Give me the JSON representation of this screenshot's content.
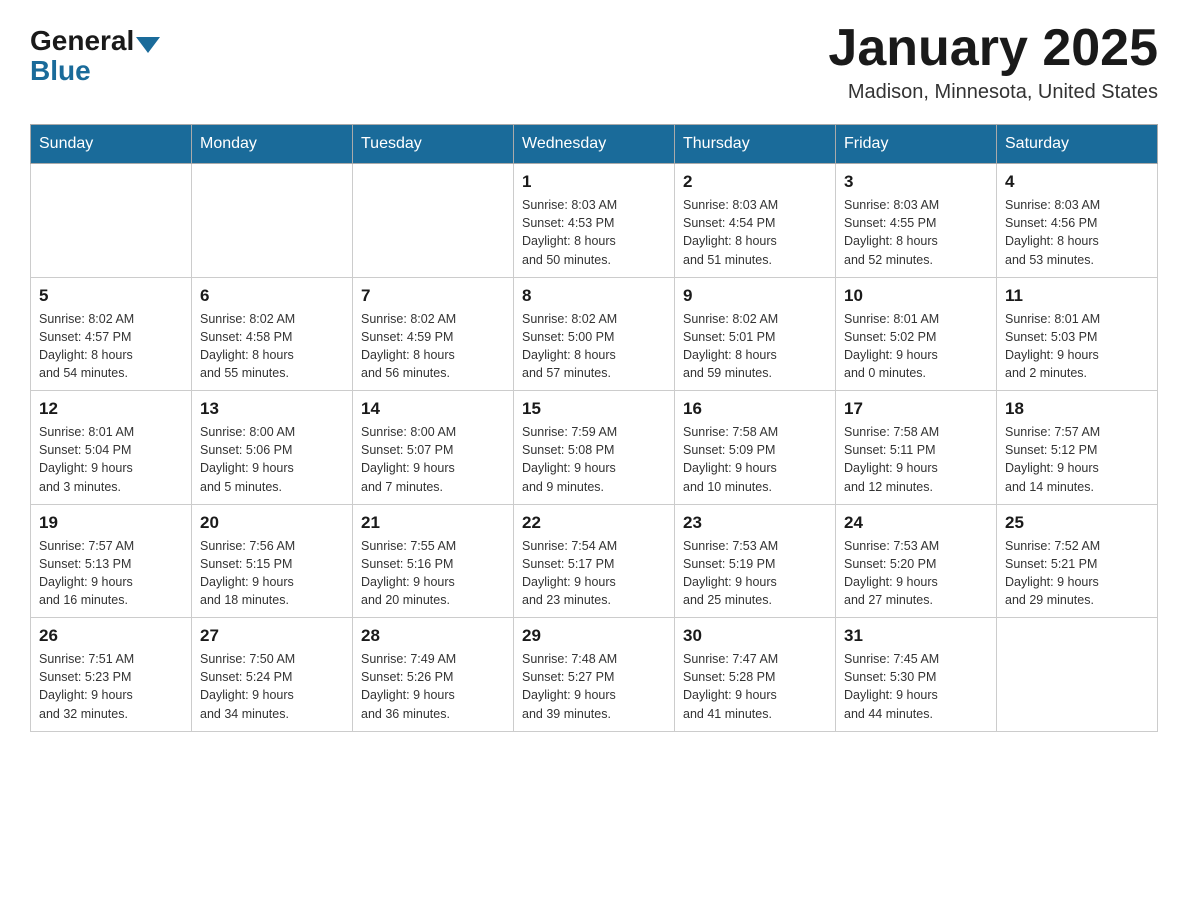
{
  "header": {
    "logo": {
      "general": "General",
      "blue": "Blue"
    },
    "title": "January 2025",
    "location": "Madison, Minnesota, United States"
  },
  "weekdays": [
    "Sunday",
    "Monday",
    "Tuesday",
    "Wednesday",
    "Thursday",
    "Friday",
    "Saturday"
  ],
  "weeks": [
    [
      {
        "day": "",
        "info": ""
      },
      {
        "day": "",
        "info": ""
      },
      {
        "day": "",
        "info": ""
      },
      {
        "day": "1",
        "info": "Sunrise: 8:03 AM\nSunset: 4:53 PM\nDaylight: 8 hours\nand 50 minutes."
      },
      {
        "day": "2",
        "info": "Sunrise: 8:03 AM\nSunset: 4:54 PM\nDaylight: 8 hours\nand 51 minutes."
      },
      {
        "day": "3",
        "info": "Sunrise: 8:03 AM\nSunset: 4:55 PM\nDaylight: 8 hours\nand 52 minutes."
      },
      {
        "day": "4",
        "info": "Sunrise: 8:03 AM\nSunset: 4:56 PM\nDaylight: 8 hours\nand 53 minutes."
      }
    ],
    [
      {
        "day": "5",
        "info": "Sunrise: 8:02 AM\nSunset: 4:57 PM\nDaylight: 8 hours\nand 54 minutes."
      },
      {
        "day": "6",
        "info": "Sunrise: 8:02 AM\nSunset: 4:58 PM\nDaylight: 8 hours\nand 55 minutes."
      },
      {
        "day": "7",
        "info": "Sunrise: 8:02 AM\nSunset: 4:59 PM\nDaylight: 8 hours\nand 56 minutes."
      },
      {
        "day": "8",
        "info": "Sunrise: 8:02 AM\nSunset: 5:00 PM\nDaylight: 8 hours\nand 57 minutes."
      },
      {
        "day": "9",
        "info": "Sunrise: 8:02 AM\nSunset: 5:01 PM\nDaylight: 8 hours\nand 59 minutes."
      },
      {
        "day": "10",
        "info": "Sunrise: 8:01 AM\nSunset: 5:02 PM\nDaylight: 9 hours\nand 0 minutes."
      },
      {
        "day": "11",
        "info": "Sunrise: 8:01 AM\nSunset: 5:03 PM\nDaylight: 9 hours\nand 2 minutes."
      }
    ],
    [
      {
        "day": "12",
        "info": "Sunrise: 8:01 AM\nSunset: 5:04 PM\nDaylight: 9 hours\nand 3 minutes."
      },
      {
        "day": "13",
        "info": "Sunrise: 8:00 AM\nSunset: 5:06 PM\nDaylight: 9 hours\nand 5 minutes."
      },
      {
        "day": "14",
        "info": "Sunrise: 8:00 AM\nSunset: 5:07 PM\nDaylight: 9 hours\nand 7 minutes."
      },
      {
        "day": "15",
        "info": "Sunrise: 7:59 AM\nSunset: 5:08 PM\nDaylight: 9 hours\nand 9 minutes."
      },
      {
        "day": "16",
        "info": "Sunrise: 7:58 AM\nSunset: 5:09 PM\nDaylight: 9 hours\nand 10 minutes."
      },
      {
        "day": "17",
        "info": "Sunrise: 7:58 AM\nSunset: 5:11 PM\nDaylight: 9 hours\nand 12 minutes."
      },
      {
        "day": "18",
        "info": "Sunrise: 7:57 AM\nSunset: 5:12 PM\nDaylight: 9 hours\nand 14 minutes."
      }
    ],
    [
      {
        "day": "19",
        "info": "Sunrise: 7:57 AM\nSunset: 5:13 PM\nDaylight: 9 hours\nand 16 minutes."
      },
      {
        "day": "20",
        "info": "Sunrise: 7:56 AM\nSunset: 5:15 PM\nDaylight: 9 hours\nand 18 minutes."
      },
      {
        "day": "21",
        "info": "Sunrise: 7:55 AM\nSunset: 5:16 PM\nDaylight: 9 hours\nand 20 minutes."
      },
      {
        "day": "22",
        "info": "Sunrise: 7:54 AM\nSunset: 5:17 PM\nDaylight: 9 hours\nand 23 minutes."
      },
      {
        "day": "23",
        "info": "Sunrise: 7:53 AM\nSunset: 5:19 PM\nDaylight: 9 hours\nand 25 minutes."
      },
      {
        "day": "24",
        "info": "Sunrise: 7:53 AM\nSunset: 5:20 PM\nDaylight: 9 hours\nand 27 minutes."
      },
      {
        "day": "25",
        "info": "Sunrise: 7:52 AM\nSunset: 5:21 PM\nDaylight: 9 hours\nand 29 minutes."
      }
    ],
    [
      {
        "day": "26",
        "info": "Sunrise: 7:51 AM\nSunset: 5:23 PM\nDaylight: 9 hours\nand 32 minutes."
      },
      {
        "day": "27",
        "info": "Sunrise: 7:50 AM\nSunset: 5:24 PM\nDaylight: 9 hours\nand 34 minutes."
      },
      {
        "day": "28",
        "info": "Sunrise: 7:49 AM\nSunset: 5:26 PM\nDaylight: 9 hours\nand 36 minutes."
      },
      {
        "day": "29",
        "info": "Sunrise: 7:48 AM\nSunset: 5:27 PM\nDaylight: 9 hours\nand 39 minutes."
      },
      {
        "day": "30",
        "info": "Sunrise: 7:47 AM\nSunset: 5:28 PM\nDaylight: 9 hours\nand 41 minutes."
      },
      {
        "day": "31",
        "info": "Sunrise: 7:45 AM\nSunset: 5:30 PM\nDaylight: 9 hours\nand 44 minutes."
      },
      {
        "day": "",
        "info": ""
      }
    ]
  ]
}
